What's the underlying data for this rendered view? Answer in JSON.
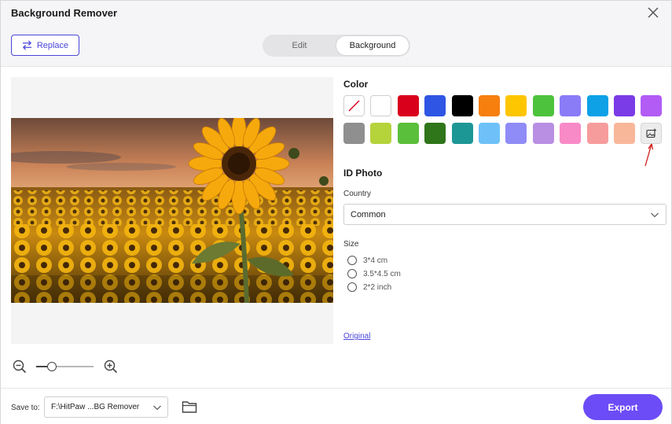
{
  "window": {
    "title": "Background Remover"
  },
  "toolbar": {
    "replace_label": "Replace"
  },
  "mode_tabs": [
    {
      "label": "Edit"
    },
    {
      "label": "Background"
    }
  ],
  "color": {
    "title": "Color",
    "row1": [
      "none",
      "#ffffff",
      "#d9001b",
      "#2f55e4",
      "#000000",
      "#f77f0e",
      "#fdc600",
      "#4dc33d",
      "#8a7cf7",
      "#0ea1e6",
      "#7a3ce6",
      "#b25cf5"
    ],
    "row2": [
      "#8f8f8f",
      "#b5d33b",
      "#5abf3a",
      "#2f7519",
      "#1d9696",
      "#6ec1f8",
      "#8f8cf7",
      "#b88fe3",
      "#f88ac7",
      "#f79c9c",
      "#f9b79a",
      "custom"
    ]
  },
  "id_photo": {
    "title": "ID Photo",
    "country_label": "Country",
    "country_value": "Common",
    "size_label": "Size",
    "sizes": [
      "3*4 cm",
      "3.5*4.5 cm",
      "2*2 inch"
    ]
  },
  "original_link": "Original",
  "footer": {
    "save_to_label": "Save to:",
    "save_path": "F:\\HitPaw ...BG Remover",
    "export_label": "Export"
  },
  "icons": {
    "close": "close-icon",
    "replace": "swap-icon",
    "zoom_out": "zoom-out-icon",
    "zoom_in": "zoom-in-icon",
    "folder": "folder-icon",
    "custom_bg": "add-image-icon",
    "dropdown": "chevron-down-icon"
  },
  "zoom": {
    "level": 0.27
  },
  "accent": "#6c4cf6"
}
